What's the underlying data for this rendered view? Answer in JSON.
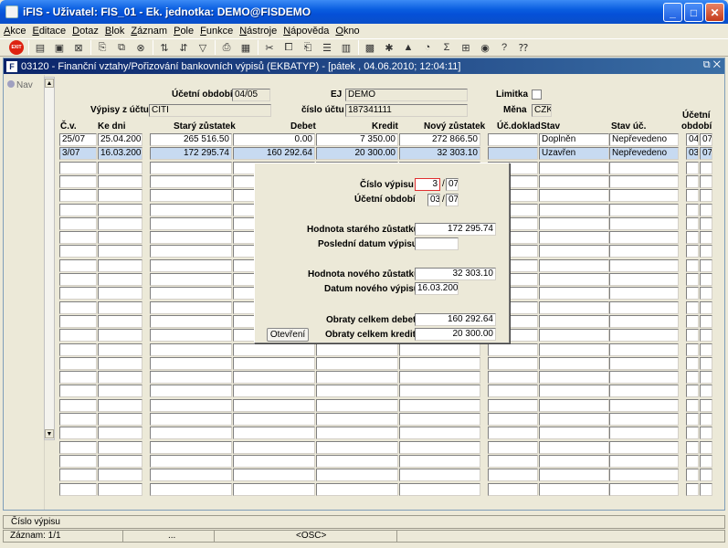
{
  "window": {
    "title": "iFIS - Uživatel: FIS_01 - Ek. jednotka: DEMO@FISDEMO"
  },
  "menu": [
    "Akce",
    "Editace",
    "Dotaz",
    "Blok",
    "Záznam",
    "Pole",
    "Funkce",
    "Nástroje",
    "Nápověda",
    "Okno"
  ],
  "toolbar": {
    "exit_label": "EXIT"
  },
  "form": {
    "title": "03120 - Finanční vztahy/Pořizování bankovních výpisů (EKBATYP) - [pátek , 04.06.2010; 12:04:11]",
    "nav_label": "Nav",
    "header": {
      "ucetni_obdobi_label": "Účetní období",
      "ucetni_obdobi_value": "04/05",
      "ej_label": "EJ",
      "ej_value": "DEMO",
      "limitka_label": "Limitka",
      "vypisy_label": "Výpisy z účtu",
      "vypisy_value": "CITI",
      "cislo_uctu_label": "číslo účtu",
      "cislo_uctu_value": "187341111",
      "mena_label": "Měna",
      "mena_value": "CZK"
    },
    "columns": {
      "cv": "Č.v.",
      "ke_dni": "Ke dni",
      "stary": "Starý zůstatek",
      "debet": "Debet",
      "kredit": "Kredit",
      "novy": "Nový zůstatek",
      "ucdoklad": "Úč.doklad",
      "stav": "Stav",
      "stav_uc": "Stav úč.",
      "obdobi_1": "Účetní",
      "obdobi_2": "období"
    },
    "rows": [
      {
        "cv": "25/07",
        "ke_dni": "25.04.2007",
        "stary": "265 516.50",
        "debet": "0.00",
        "kredit": "7 350.00",
        "novy": "272 866.50",
        "ucdoklad": "",
        "stav": "Doplněn",
        "stav_uc": "Nepřevedeno",
        "obd_m": "04",
        "obd_y": "07"
      },
      {
        "cv": "3/07",
        "ke_dni": "16.03.2007",
        "stary": "172 295.74",
        "debet": "160 292.64",
        "kredit": "20 300.00",
        "novy": "32 303.10",
        "ucdoklad": "",
        "stav": "Uzavřen",
        "stav_uc": "Nepřevedeno",
        "obd_m": "03",
        "obd_y": "07"
      }
    ]
  },
  "dialog": {
    "cislo_vypisu_label": "Číslo výpisu",
    "cislo_vypisu_value": "3",
    "cislo_vypisu_rok": "07",
    "ucetni_obdobi_label": "Účetní období",
    "ucetni_obdobi_m": "03",
    "ucetni_obdobi_y": "07",
    "hodnota_stareho_label": "Hodnota starého zůstatku",
    "hodnota_stareho_value": "172 295.74",
    "posledni_datum_label": "Poslední datum výpisu",
    "posledni_datum_value": "",
    "hodnota_noveho_label": "Hodnota nového zůstatku",
    "hodnota_noveho_value": "32 303.10",
    "datum_noveho_label": "Datum nového výpisu",
    "datum_noveho_value": "16.03.2007",
    "obraty_debet_label": "Obraty celkem debet",
    "obraty_debet_value": "160 292.64",
    "obraty_kredit_label": "Obraty celkem kredit",
    "obraty_kredit_value": "20 300.00",
    "open_button": "Otevření",
    "slash": "/"
  },
  "status": {
    "hint": "Číslo výpisu",
    "record": "Záznam: 1/1",
    "dots": "...",
    "osc": "<OSC>"
  }
}
